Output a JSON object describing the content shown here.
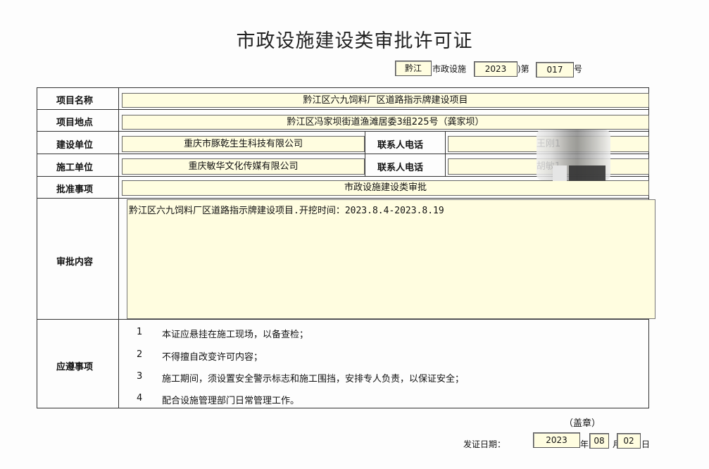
{
  "title": "市政设施建设类审批许可证",
  "number_line": {
    "city": "黔江",
    "text1": "市政设施",
    "year": "2023",
    "text2": ")第",
    "num": "017",
    "text3": "号"
  },
  "rows": {
    "project_name_label": "项目名称",
    "project_name": "黔江区六九饲料厂区道路指示牌建设项目",
    "project_location_label": "项目地点",
    "project_location": "黔江区冯家坝街道渔滩居委3组225号（龚家坝）",
    "builder_label": "建设单位",
    "builder": "重庆市豚乾生生科技有限公司",
    "builder_contact_label": "联系人电话",
    "builder_contact": "王刚1",
    "constructor_label": "施工单位",
    "constructor": "重庆敏华文化传媒有限公司",
    "constructor_contact_label": "联系人电话",
    "constructor_contact": "胡敏1",
    "approval_item_label": "批准事项",
    "approval_item": "市政设施建设类审批",
    "approval_content_label": "审批内容",
    "approval_content": "黔江区六九饲料厂区道路指示牌建设项目.开挖时间：2023.8.4-2023.8.19",
    "notes_label": "应遵事项"
  },
  "notes": [
    {
      "n": "1",
      "text": "本证应悬挂在施工现场，以备查检；"
    },
    {
      "n": "2",
      "text": "不得擅自改变许可内容；"
    },
    {
      "n": "3",
      "text": "施工期间，须设置安全警示标志和施工围挡，安排专人负责，以保证安全；"
    },
    {
      "n": "4",
      "text": "配合设施管理部门日常管理工作。"
    }
  ],
  "footer": {
    "seal": "（盖章）",
    "issue_label": "发证日期：",
    "year": "2023",
    "year_unit": "年",
    "month": "08",
    "month_unit": "月",
    "day": "02",
    "day_unit": "日"
  }
}
